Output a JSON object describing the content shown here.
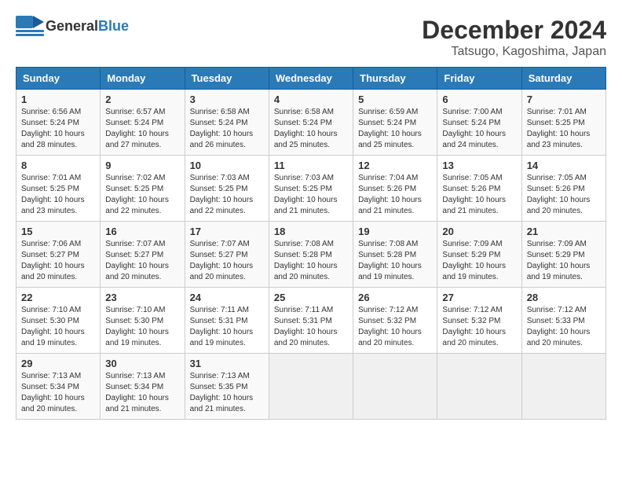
{
  "header": {
    "logo_general": "General",
    "logo_blue": "Blue",
    "month_title": "December 2024",
    "location": "Tatsugo, Kagoshima, Japan"
  },
  "days_of_week": [
    "Sunday",
    "Monday",
    "Tuesday",
    "Wednesday",
    "Thursday",
    "Friday",
    "Saturday"
  ],
  "weeks": [
    [
      {
        "day": "1",
        "sunrise": "6:56 AM",
        "sunset": "5:24 PM",
        "daylight": "10 hours and 28 minutes."
      },
      {
        "day": "2",
        "sunrise": "6:57 AM",
        "sunset": "5:24 PM",
        "daylight": "10 hours and 27 minutes."
      },
      {
        "day": "3",
        "sunrise": "6:58 AM",
        "sunset": "5:24 PM",
        "daylight": "10 hours and 26 minutes."
      },
      {
        "day": "4",
        "sunrise": "6:58 AM",
        "sunset": "5:24 PM",
        "daylight": "10 hours and 25 minutes."
      },
      {
        "day": "5",
        "sunrise": "6:59 AM",
        "sunset": "5:24 PM",
        "daylight": "10 hours and 25 minutes."
      },
      {
        "day": "6",
        "sunrise": "7:00 AM",
        "sunset": "5:24 PM",
        "daylight": "10 hours and 24 minutes."
      },
      {
        "day": "7",
        "sunrise": "7:01 AM",
        "sunset": "5:25 PM",
        "daylight": "10 hours and 23 minutes."
      }
    ],
    [
      {
        "day": "8",
        "sunrise": "7:01 AM",
        "sunset": "5:25 PM",
        "daylight": "10 hours and 23 minutes."
      },
      {
        "day": "9",
        "sunrise": "7:02 AM",
        "sunset": "5:25 PM",
        "daylight": "10 hours and 22 minutes."
      },
      {
        "day": "10",
        "sunrise": "7:03 AM",
        "sunset": "5:25 PM",
        "daylight": "10 hours and 22 minutes."
      },
      {
        "day": "11",
        "sunrise": "7:03 AM",
        "sunset": "5:25 PM",
        "daylight": "10 hours and 21 minutes."
      },
      {
        "day": "12",
        "sunrise": "7:04 AM",
        "sunset": "5:26 PM",
        "daylight": "10 hours and 21 minutes."
      },
      {
        "day": "13",
        "sunrise": "7:05 AM",
        "sunset": "5:26 PM",
        "daylight": "10 hours and 21 minutes."
      },
      {
        "day": "14",
        "sunrise": "7:05 AM",
        "sunset": "5:26 PM",
        "daylight": "10 hours and 20 minutes."
      }
    ],
    [
      {
        "day": "15",
        "sunrise": "7:06 AM",
        "sunset": "5:27 PM",
        "daylight": "10 hours and 20 minutes."
      },
      {
        "day": "16",
        "sunrise": "7:07 AM",
        "sunset": "5:27 PM",
        "daylight": "10 hours and 20 minutes."
      },
      {
        "day": "17",
        "sunrise": "7:07 AM",
        "sunset": "5:27 PM",
        "daylight": "10 hours and 20 minutes."
      },
      {
        "day": "18",
        "sunrise": "7:08 AM",
        "sunset": "5:28 PM",
        "daylight": "10 hours and 20 minutes."
      },
      {
        "day": "19",
        "sunrise": "7:08 AM",
        "sunset": "5:28 PM",
        "daylight": "10 hours and 19 minutes."
      },
      {
        "day": "20",
        "sunrise": "7:09 AM",
        "sunset": "5:29 PM",
        "daylight": "10 hours and 19 minutes."
      },
      {
        "day": "21",
        "sunrise": "7:09 AM",
        "sunset": "5:29 PM",
        "daylight": "10 hours and 19 minutes."
      }
    ],
    [
      {
        "day": "22",
        "sunrise": "7:10 AM",
        "sunset": "5:30 PM",
        "daylight": "10 hours and 19 minutes."
      },
      {
        "day": "23",
        "sunrise": "7:10 AM",
        "sunset": "5:30 PM",
        "daylight": "10 hours and 19 minutes."
      },
      {
        "day": "24",
        "sunrise": "7:11 AM",
        "sunset": "5:31 PM",
        "daylight": "10 hours and 19 minutes."
      },
      {
        "day": "25",
        "sunrise": "7:11 AM",
        "sunset": "5:31 PM",
        "daylight": "10 hours and 20 minutes."
      },
      {
        "day": "26",
        "sunrise": "7:12 AM",
        "sunset": "5:32 PM",
        "daylight": "10 hours and 20 minutes."
      },
      {
        "day": "27",
        "sunrise": "7:12 AM",
        "sunset": "5:32 PM",
        "daylight": "10 hours and 20 minutes."
      },
      {
        "day": "28",
        "sunrise": "7:12 AM",
        "sunset": "5:33 PM",
        "daylight": "10 hours and 20 minutes."
      }
    ],
    [
      {
        "day": "29",
        "sunrise": "7:13 AM",
        "sunset": "5:34 PM",
        "daylight": "10 hours and 20 minutes."
      },
      {
        "day": "30",
        "sunrise": "7:13 AM",
        "sunset": "5:34 PM",
        "daylight": "10 hours and 21 minutes."
      },
      {
        "day": "31",
        "sunrise": "7:13 AM",
        "sunset": "5:35 PM",
        "daylight": "10 hours and 21 minutes."
      },
      null,
      null,
      null,
      null
    ]
  ]
}
